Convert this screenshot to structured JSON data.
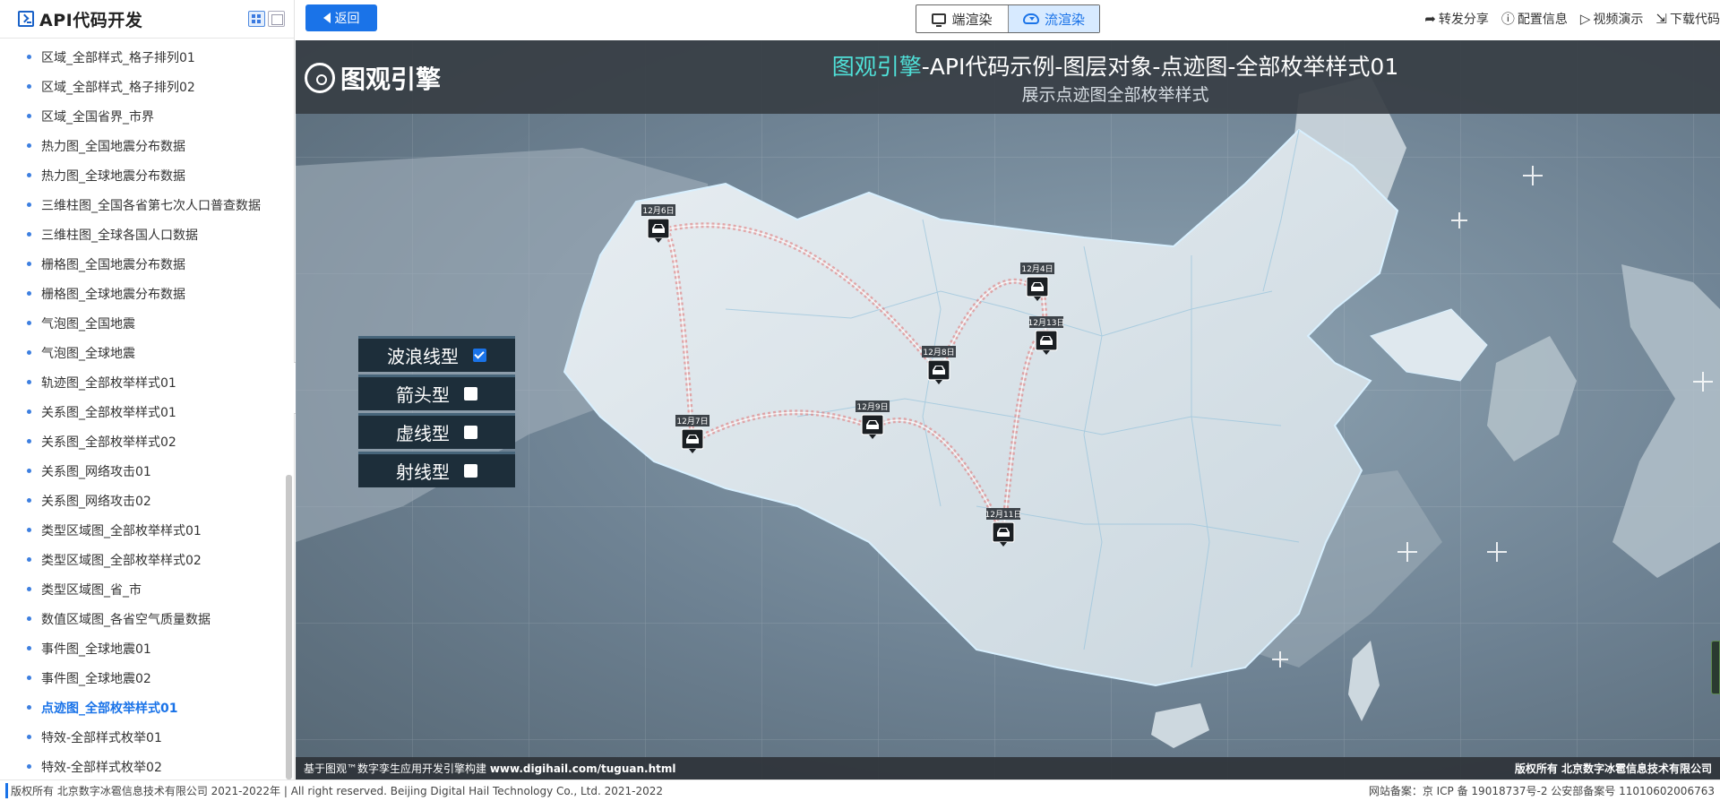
{
  "sidebar": {
    "title": "API代码开发",
    "items": [
      {
        "label": "区域_全部样式_格子排列01",
        "active": false
      },
      {
        "label": "区域_全部样式_格子排列02",
        "active": false
      },
      {
        "label": "区域_全国省界_市界",
        "active": false
      },
      {
        "label": "热力图_全国地震分布数据",
        "active": false
      },
      {
        "label": "热力图_全球地震分布数据",
        "active": false
      },
      {
        "label": "三维柱图_全国各省第七次人口普查数据",
        "active": false
      },
      {
        "label": "三维柱图_全球各国人口数据",
        "active": false
      },
      {
        "label": "栅格图_全国地震分布数据",
        "active": false
      },
      {
        "label": "栅格图_全球地震分布数据",
        "active": false
      },
      {
        "label": "气泡图_全国地震",
        "active": false
      },
      {
        "label": "气泡图_全球地震",
        "active": false
      },
      {
        "label": "轨迹图_全部枚举样式01",
        "active": false
      },
      {
        "label": "关系图_全部枚举样式01",
        "active": false
      },
      {
        "label": "关系图_全部枚举样式02",
        "active": false
      },
      {
        "label": "关系图_网络攻击01",
        "active": false
      },
      {
        "label": "关系图_网络攻击02",
        "active": false
      },
      {
        "label": "类型区域图_全部枚举样式01",
        "active": false
      },
      {
        "label": "类型区域图_全部枚举样式02",
        "active": false
      },
      {
        "label": "类型区域图_省_市",
        "active": false
      },
      {
        "label": "数值区域图_各省空气质量数据",
        "active": false
      },
      {
        "label": "事件图_全球地震01",
        "active": false
      },
      {
        "label": "事件图_全球地震02",
        "active": false
      },
      {
        "label": "点迹图_全部枚举样式01",
        "active": true
      },
      {
        "label": "特效-全部样式枚举01",
        "active": false
      },
      {
        "label": "特效-全部样式枚举02",
        "active": false
      }
    ]
  },
  "toolbar": {
    "back_label": "返回",
    "render_client": "端渲染",
    "render_stream": "流渲染",
    "share": "转发分享",
    "config": "配置信息",
    "video": "视频演示",
    "download": "下载代码"
  },
  "viewer": {
    "brand": "图观引擎",
    "title_highlight": "图观引擎",
    "title_rest": "-API代码示例-图层对象-点迹图-全部枚举样式01",
    "subtitle": "展示点迹图全部枚举样式",
    "footer_left_prefix": "基于图观™数字孪生应用开发引擎构建 ",
    "footer_left_url": "www.digihail.com/tuguan.html",
    "footer_right": "版权所有 北京数字冰雹信息技术有限公司"
  },
  "style_options": [
    {
      "label": "波浪线型",
      "checked": true
    },
    {
      "label": "箭头型",
      "checked": false
    },
    {
      "label": "虚线型",
      "checked": false
    },
    {
      "label": "射线型",
      "checked": false
    }
  ],
  "track_points": [
    {
      "date": "12月6日"
    },
    {
      "date": "12月4日"
    },
    {
      "date": "12月13日"
    },
    {
      "date": "12月8日"
    },
    {
      "date": "12月7日"
    },
    {
      "date": "12月9日"
    },
    {
      "date": "12月11日"
    }
  ],
  "page_footer": {
    "left": "版权所有 北京数字冰雹信息技术有限公司 2021-2022年 | All right reserved. Beijing Digital Hail Technology Co., Ltd. 2021-2022",
    "right": "网站备案：京 ICP 备 19018737号-2 公安部备案号 11010602006763"
  },
  "colors": {
    "accent": "#1a73e8",
    "title_highlight": "#4fe0d8",
    "track_line": "#e07070"
  }
}
